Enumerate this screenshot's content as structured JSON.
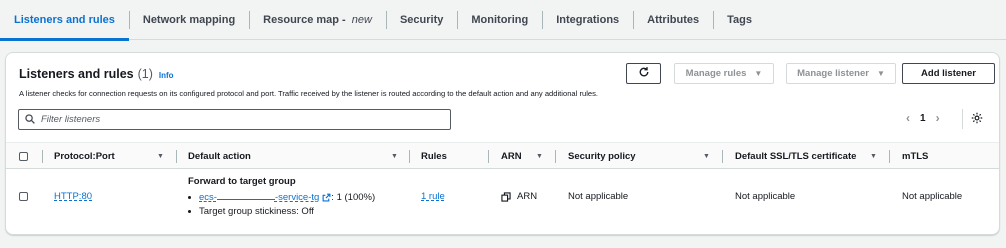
{
  "tabs": [
    {
      "label": "Listeners and rules",
      "suffix": "",
      "active": true
    },
    {
      "label": "Network mapping",
      "suffix": "",
      "active": false
    },
    {
      "label": "Resource map - ",
      "suffix": "new",
      "active": false
    },
    {
      "label": "Security",
      "suffix": "",
      "active": false
    },
    {
      "label": "Monitoring",
      "suffix": "",
      "active": false
    },
    {
      "label": "Integrations",
      "suffix": "",
      "active": false
    },
    {
      "label": "Attributes",
      "suffix": "",
      "active": false
    },
    {
      "label": "Tags",
      "suffix": "",
      "active": false
    }
  ],
  "panel": {
    "title": "Listeners and rules",
    "count": "(1)",
    "info": "Info",
    "description": "A listener checks for connection requests on its configured protocol and port. Traffic received by the listener is routed according to the default action and any additional rules.",
    "buttons": {
      "refresh_icon": "refresh-icon",
      "manage_rules": "Manage rules",
      "manage_listener": "Manage listener",
      "add_listener": "Add listener"
    },
    "filter_placeholder": "Filter listeners",
    "page": "1"
  },
  "table": {
    "headers": {
      "protocol_port": "Protocol:Port",
      "default_action": "Default action",
      "rules": "Rules",
      "arn": "ARN",
      "security_policy": "Security policy",
      "ssl_cert": "Default SSL/TLS certificate",
      "mtls": "mTLS"
    },
    "rows": [
      {
        "protocol_port": "HTTP:80",
        "action_title": "Forward to target group",
        "tg_prefix": "ecs-",
        "tg_suffix": "-service-tg",
        "tg_weight": ": 1 (100%)",
        "stickiness": "Target group stickiness: Off",
        "rules": "1 rule",
        "arn": "ARN",
        "security_policy": "Not applicable",
        "ssl_cert": "Not applicable",
        "mtls": "Not applicable"
      }
    ]
  },
  "colors": {
    "accent": "#0972d3",
    "border": "#d5dbdb",
    "background": "#f2f3f3"
  }
}
